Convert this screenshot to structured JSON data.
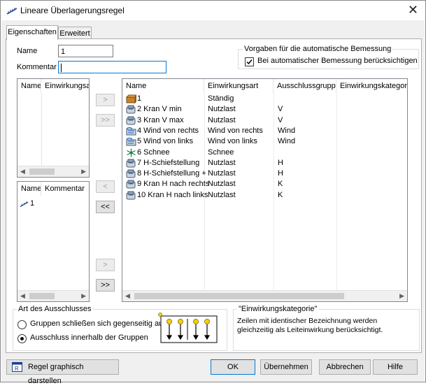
{
  "window": {
    "title": "Lineare Überlagerungsregel"
  },
  "tabs": [
    {
      "label": "Eigenschaften"
    },
    {
      "label": "Erweitert"
    }
  ],
  "form": {
    "name_label": "Name",
    "name_value": "1",
    "comment_label": "Kommentar",
    "comment_value": ""
  },
  "defaults_group": {
    "title": "Vorgaben für die automatische Bemessung",
    "checkbox_label": "Bei automatischer Bemessung berücksichtigen",
    "checked": true
  },
  "left_top_list": {
    "columns": [
      "Name",
      "Einwirkungsart"
    ]
  },
  "left_bottom_list": {
    "columns": [
      "Name",
      "Kommentar"
    ],
    "rows": [
      {
        "name": "1"
      }
    ]
  },
  "transfer_buttons": {
    "add_one": ">",
    "add_all": ">>",
    "remove_one": "<",
    "remove_all": "<<",
    "add_one_2": ">",
    "add_all_2": ">>"
  },
  "main_list": {
    "columns": [
      "Name",
      "Einwirkungsart",
      "Ausschlussgruppe",
      "Einwirkungskategorie"
    ],
    "rows": [
      {
        "icon": "permanent-load-icon",
        "name": "1",
        "type": "Ständig",
        "group": ""
      },
      {
        "icon": "crane-icon",
        "name": "2 Kran V min",
        "type": "Nutzlast",
        "group": "V"
      },
      {
        "icon": "crane-icon",
        "name": "3 Kran V max",
        "type": "Nutzlast",
        "group": "V"
      },
      {
        "icon": "wind-icon",
        "name": "4 Wind von rechts",
        "type": "Wind von rechts",
        "group": "Wind"
      },
      {
        "icon": "wind-icon",
        "name": "5 Wind von links",
        "type": "Wind von links",
        "group": "Wind"
      },
      {
        "icon": "snow-icon",
        "name": "6 Schnee",
        "type": "Schnee",
        "group": ""
      },
      {
        "icon": "crane-icon",
        "name": "7 H-Schiefstellung",
        "type": "Nutzlast",
        "group": "H"
      },
      {
        "icon": "crane-icon",
        "name": "8 H-Schiefstellung +",
        "type": "Nutzlast",
        "group": "H"
      },
      {
        "icon": "crane-icon",
        "name": "9 Kran H nach rechts",
        "type": "Nutzlast",
        "group": "K"
      },
      {
        "icon": "crane-icon",
        "name": "10 Kran H nach links",
        "type": "Nutzlast",
        "group": "K"
      }
    ]
  },
  "exclusion_group": {
    "title": "Art des Ausschlusses",
    "option1": "Gruppen schließen sich gegenseitig aus",
    "option2": "Ausschluss innerhalb der Gruppen",
    "selected": 2
  },
  "category_group": {
    "title": "\"Einwirkungskategorie\"",
    "description": "Zeilen mit identischer Bezeichnung werden gleichzeitig als Leiteinwirkung berücksichtigt."
  },
  "footer": {
    "graphic_label": "Regel graphisch darstellen",
    "ok": "OK",
    "apply": "Übernehmen",
    "cancel": "Abbrechen",
    "help": "Hilfe"
  }
}
